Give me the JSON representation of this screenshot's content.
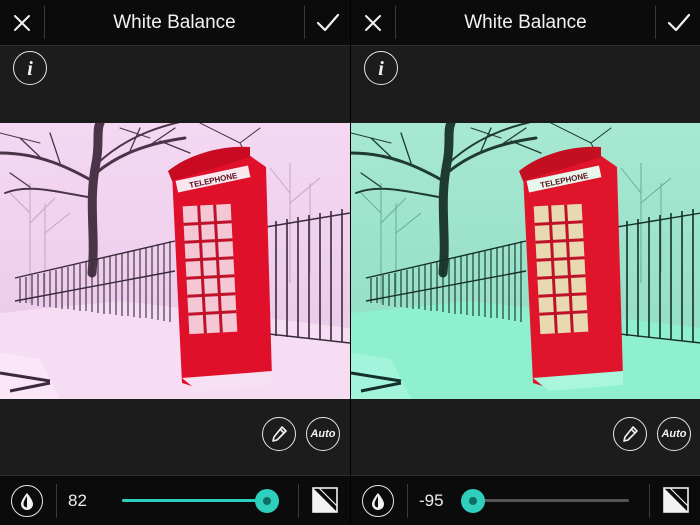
{
  "panels": [
    {
      "title": "White Balance",
      "value": "82",
      "slider_fraction": 0.93,
      "auto_label": "Auto",
      "booth_sign": "TELEPHONE",
      "tint": "pink"
    },
    {
      "title": "White Balance",
      "value": "-95",
      "slider_fraction": 0.0,
      "auto_label": "Auto",
      "booth_sign": "TELEPHONE",
      "tint": "green"
    }
  ],
  "icons": {
    "close": "close-icon",
    "apply": "checkmark-icon",
    "info": "info-icon",
    "picker": "eyedropper-icon",
    "drop": "drop-icon",
    "compare": "compare-icon"
  },
  "colors": {
    "accent": "#2fcfbd",
    "bar_background": "#0b0b0b",
    "panel_background": "#1c1c1c",
    "pink_tint_sky": "#f1d2ee",
    "pink_tint_snow": "#f6d8f2",
    "green_tint_sky": "#9be6cd",
    "green_tint_snow": "#8ff0d0",
    "booth_red": "#e0102a"
  }
}
